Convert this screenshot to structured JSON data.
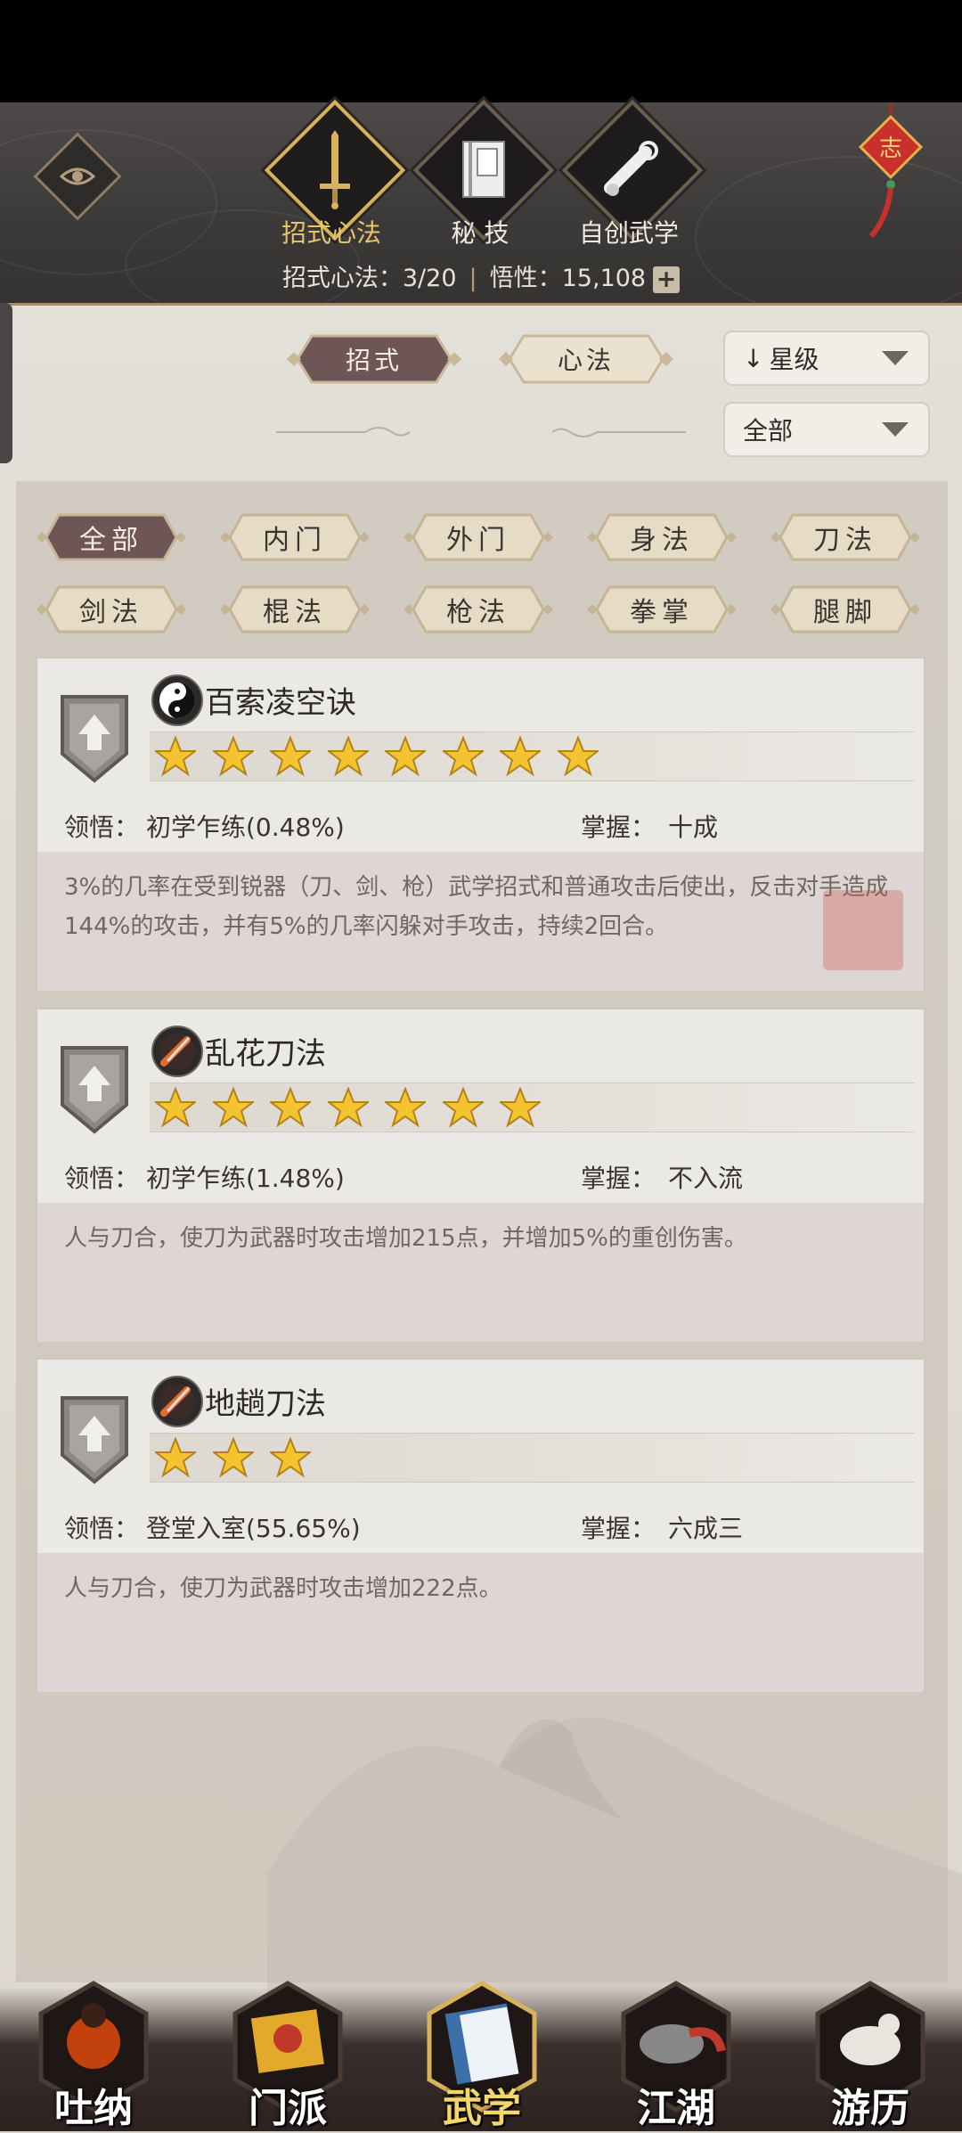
{
  "header": {
    "tabs": [
      {
        "label": "招式心法",
        "selected": true,
        "icon": "sword-icon"
      },
      {
        "label": "秘  技",
        "selected": false,
        "icon": "book-icon"
      },
      {
        "label": "自创武学",
        "selected": false,
        "icon": "scroll-icon"
      }
    ],
    "stat_label": "招式心法：3/20",
    "wuxing_label": "悟性：15,108",
    "plus": "+"
  },
  "toggle": {
    "zhaoshi": "招式",
    "xinfa": "心法"
  },
  "dropdowns": {
    "sort": "星级",
    "filter": "全部"
  },
  "categories": [
    "全部",
    "内门",
    "外门",
    "身法",
    "刀法",
    "剑法",
    "棍法",
    "枪法",
    "拳掌",
    "腿脚"
  ],
  "skills": [
    {
      "name": "百索凌空诀",
      "icon": "taiji-icon",
      "stars": 8,
      "lingwu_label": "领悟：",
      "lingwu": "初学乍练(0.48%)",
      "zhangwo_label": "掌握：",
      "zhangwo": "十成",
      "desc": "3%的几率在受到锐器（刀、剑、枪）武学招式和普通攻击后使出，反击对手造成144%的攻击，并有5%的几率闪躲对手攻击，持续2回合。"
    },
    {
      "name": "乱花刀法",
      "icon": "blade-icon",
      "stars": 7,
      "lingwu_label": "领悟：",
      "lingwu": "初学乍练(1.48%)",
      "zhangwo_label": "掌握：",
      "zhangwo": "不入流",
      "desc": "人与刀合，使刀为武器时攻击增加215点，并增加5%的重创伤害。"
    },
    {
      "name": "地趟刀法",
      "icon": "blade-icon",
      "stars": 3,
      "lingwu_label": "领悟：",
      "lingwu": "登堂入室(55.65%)",
      "zhangwo_label": "掌握：",
      "zhangwo": "六成三",
      "desc": "人与刀合，使刀为武器时攻击增加222点。"
    }
  ],
  "nav": [
    {
      "label": "吐纳",
      "selected": false
    },
    {
      "label": "门派",
      "selected": false
    },
    {
      "label": "武学",
      "selected": true
    },
    {
      "label": "江湖",
      "selected": false
    },
    {
      "label": "游历",
      "selected": false
    }
  ],
  "colors": {
    "accent": "#e8c46a",
    "chip_active": "#6f5656",
    "chip_idle": "#e6dcc6"
  }
}
